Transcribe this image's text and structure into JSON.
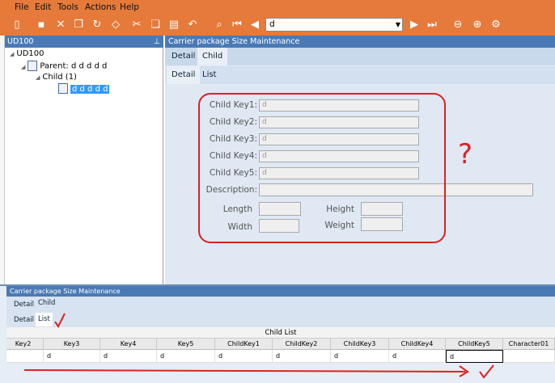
{
  "menu": [
    "File",
    "Edit",
    "Tools",
    "Actions",
    "Help"
  ],
  "toolbar": {
    "search_value": "d",
    "icons": [
      "new-icon",
      "save-icon",
      "delete-icon",
      "copy-icon",
      "refresh-icon",
      "eraser-icon",
      "cut-icon",
      "paste-icon",
      "clipboard-icon",
      "undo-icon",
      "find-icon",
      "first-record-icon",
      "prev-record-icon",
      "next-record-icon",
      "last-record-icon",
      "back-icon",
      "forward-icon",
      "settings-icon"
    ]
  },
  "tree": {
    "header": "UD100",
    "root": "UD100",
    "parent": "Parent: d d d d d",
    "child_group": "Child (1)",
    "child_item": "d d d d d"
  },
  "detail": {
    "header": "Carrier package Size Maintenance",
    "tabs_top": [
      "Detail",
      "Child"
    ],
    "tabs_sub": [
      "Detail",
      "List"
    ],
    "fields": [
      {
        "label": "Child Key1:",
        "value": "d"
      },
      {
        "label": "Child Key2:",
        "value": "d"
      },
      {
        "label": "Child Key3:",
        "value": "d"
      },
      {
        "label": "Child Key4:",
        "value": "d"
      },
      {
        "label": "Child Key5:",
        "value": "d"
      }
    ],
    "description_label": "Description:",
    "length_label": "Length",
    "width_label": "Width",
    "height_label": "Height",
    "weight_label": "Weight",
    "annotation": "?"
  },
  "bottom": {
    "header": "Carrier package Size Maintenance",
    "tabs_top": [
      "Detail",
      "Child"
    ],
    "tabs_sub": [
      "Detail",
      "List"
    ],
    "grid_title": "Child List",
    "columns": [
      "Key2",
      "Key3",
      "Key4",
      "Key5",
      "ChildKey1",
      "ChildKey2",
      "ChildKey3",
      "ChildKey4",
      "ChildKey5",
      "Character01"
    ],
    "row": [
      "",
      "d",
      "d",
      "d",
      "d",
      "d",
      "d",
      "d",
      "d",
      ""
    ]
  },
  "colors": {
    "toolbar": "#e67a3a",
    "header_blue": "#4a7ab5",
    "annotation_red": "#e02020"
  }
}
